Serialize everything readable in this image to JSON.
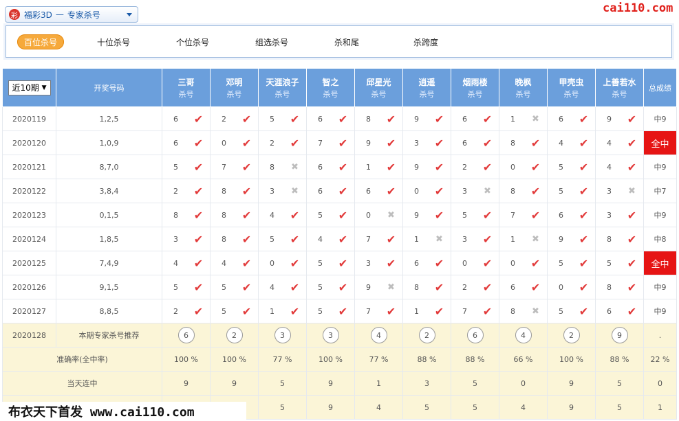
{
  "header": {
    "lottery_logo": "彩",
    "lottery_name": "福彩3D",
    "separator": "—",
    "section_name": "专家杀号",
    "brand_logo": "cai110.com"
  },
  "tabs": [
    {
      "label": "百位杀号",
      "active": true
    },
    {
      "label": "十位杀号",
      "active": false
    },
    {
      "label": "个位杀号",
      "active": false
    },
    {
      "label": "组选杀号",
      "active": false
    },
    {
      "label": "杀和尾",
      "active": false
    },
    {
      "label": "杀跨度",
      "active": false
    }
  ],
  "table": {
    "period_select": "近10期",
    "draw_header": "开奖号码",
    "score_header": "总成绩",
    "sub_label": "杀号",
    "experts": [
      "三哥",
      "邓明",
      "天涯浪子",
      "智之",
      "邱星光",
      "逍遥",
      "烟雨楼",
      "晚枫",
      "甲壳虫",
      "上善若水"
    ],
    "rows": [
      {
        "period": "2020119",
        "draw": "1,2,5",
        "kills": [
          "6",
          "2",
          "5",
          "6",
          "8",
          "9",
          "6",
          "1",
          "6",
          "9"
        ],
        "hits": [
          true,
          true,
          true,
          true,
          true,
          true,
          true,
          false,
          true,
          true
        ],
        "score": "中9",
        "full": false
      },
      {
        "period": "2020120",
        "draw": "1,0,9",
        "kills": [
          "6",
          "0",
          "2",
          "7",
          "9",
          "3",
          "6",
          "8",
          "4",
          "4"
        ],
        "hits": [
          true,
          true,
          true,
          true,
          true,
          true,
          true,
          true,
          true,
          true
        ],
        "score": "全中",
        "full": true
      },
      {
        "period": "2020121",
        "draw": "8,7,0",
        "kills": [
          "5",
          "7",
          "8",
          "6",
          "1",
          "9",
          "2",
          "0",
          "5",
          "4"
        ],
        "hits": [
          true,
          true,
          false,
          true,
          true,
          true,
          true,
          true,
          true,
          true
        ],
        "score": "中9",
        "full": false
      },
      {
        "period": "2020122",
        "draw": "3,8,4",
        "kills": [
          "2",
          "8",
          "3",
          "6",
          "6",
          "0",
          "3",
          "8",
          "5",
          "3"
        ],
        "hits": [
          true,
          true,
          false,
          true,
          true,
          true,
          false,
          true,
          true,
          false
        ],
        "score": "中7",
        "full": false
      },
      {
        "period": "2020123",
        "draw": "0,1,5",
        "kills": [
          "8",
          "8",
          "4",
          "5",
          "0",
          "9",
          "5",
          "7",
          "6",
          "3"
        ],
        "hits": [
          true,
          true,
          true,
          true,
          false,
          true,
          true,
          true,
          true,
          true
        ],
        "score": "中9",
        "full": false
      },
      {
        "period": "2020124",
        "draw": "1,8,5",
        "kills": [
          "3",
          "8",
          "5",
          "4",
          "7",
          "1",
          "3",
          "1",
          "9",
          "8"
        ],
        "hits": [
          true,
          true,
          true,
          true,
          true,
          false,
          true,
          false,
          true,
          true
        ],
        "score": "中8",
        "full": false
      },
      {
        "period": "2020125",
        "draw": "7,4,9",
        "kills": [
          "4",
          "4",
          "0",
          "5",
          "3",
          "6",
          "0",
          "0",
          "5",
          "5"
        ],
        "hits": [
          true,
          true,
          true,
          true,
          true,
          true,
          true,
          true,
          true,
          true
        ],
        "score": "全中",
        "full": true
      },
      {
        "period": "2020126",
        "draw": "9,1,5",
        "kills": [
          "5",
          "5",
          "4",
          "5",
          "9",
          "8",
          "2",
          "6",
          "0",
          "8"
        ],
        "hits": [
          true,
          true,
          true,
          true,
          false,
          true,
          true,
          true,
          true,
          true
        ],
        "score": "中9",
        "full": false
      },
      {
        "period": "2020127",
        "draw": "8,8,5",
        "kills": [
          "2",
          "5",
          "1",
          "5",
          "7",
          "1",
          "7",
          "8",
          "5",
          "6"
        ],
        "hits": [
          true,
          true,
          true,
          true,
          true,
          true,
          true,
          false,
          true,
          true
        ],
        "score": "中9",
        "full": false
      }
    ],
    "recommend": {
      "period": "2020128",
      "label": "本期专家杀号推荐",
      "numbers": [
        "6",
        "2",
        "3",
        "3",
        "4",
        "2",
        "6",
        "4",
        "2",
        "9"
      ],
      "score": "."
    },
    "accuracy": {
      "label": "准确率(全中率)",
      "values": [
        "100 %",
        "100 %",
        "77 %",
        "100 %",
        "77 %",
        "88 %",
        "88 %",
        "66 %",
        "100 %",
        "88 %"
      ],
      "total": "22 %"
    },
    "streak": {
      "label": "当天连中",
      "values": [
        "9",
        "9",
        "5",
        "9",
        "1",
        "3",
        "5",
        "0",
        "9",
        "5"
      ],
      "total": "0"
    },
    "last_row": {
      "values": [
        "",
        "",
        "5",
        "9",
        "4",
        "5",
        "5",
        "4",
        "9",
        "5"
      ],
      "total": "1"
    }
  },
  "watermark": "布衣天下首发 www.cai110.com",
  "colors": {
    "header_blue": "#6b9fdc",
    "hit_red": "#e23a3a",
    "full_hit_bg": "#e61414",
    "active_tab": "#f6a93b",
    "summary_bg": "#fbf5d7"
  }
}
